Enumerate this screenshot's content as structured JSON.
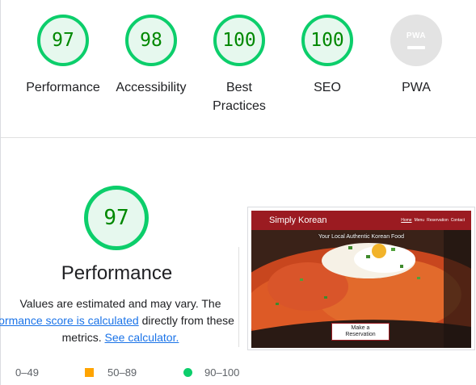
{
  "scores": [
    {
      "name": "Performance",
      "score": "97"
    },
    {
      "name": "Accessibility",
      "score": "98"
    },
    {
      "name": "Best Practices",
      "score": "100"
    },
    {
      "name": "SEO",
      "score": "100"
    },
    {
      "name": "PWA",
      "badge": "PWA"
    }
  ],
  "performance": {
    "score": "97",
    "title": "Performance",
    "desc_line1": "Values are estimated and may vary. The",
    "desc_link1": "performance score is calculated",
    "desc_line2_rest": " directly from these",
    "desc_line3_pre": "metrics. ",
    "desc_link2": "See calculator.",
    "legend": {
      "fail": "0–49",
      "average": "50–89",
      "pass": "90–100"
    }
  },
  "screenshot": {
    "brand": "Simply Korean",
    "nav": [
      "Home",
      "Menu",
      "Reservation",
      "Contact"
    ],
    "tagline": "Your Local Authentic Korean Food",
    "cta_line1": "Make a",
    "cta_line2": "Reservation"
  },
  "colors": {
    "pass": "#0cce6b",
    "average": "#ffa400",
    "fail": "#ff4e42",
    "accent_red": "#9b1b21",
    "link": "#1a73e8"
  }
}
